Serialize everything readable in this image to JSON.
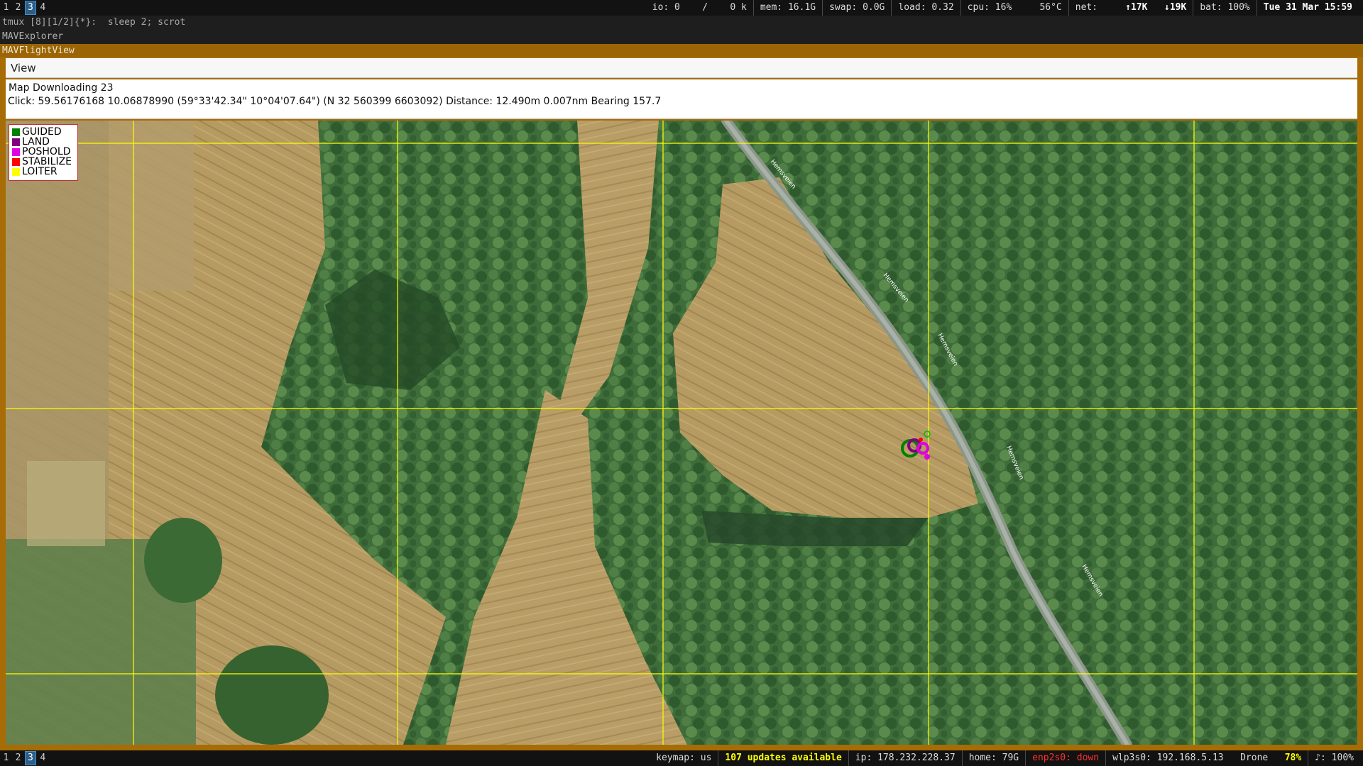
{
  "top_bar": {
    "workspaces": [
      "1",
      "2",
      "3",
      "4"
    ],
    "active_workspace": "3",
    "io": "io: 0",
    "io_sep": "/",
    "io_k": "0 k",
    "mem": "mem: 16.1G",
    "swap": "swap: 0.0G",
    "load": "load: 0.32",
    "cpu": "cpu:  16%",
    "temp": "56°C",
    "net_label": "net:",
    "net_up": "↑17K",
    "net_down": "↓19K",
    "bat": "bat: 100%",
    "datetime": "Tue 31 Mar 15:59"
  },
  "tmux_line": "tmux [8][1/2]{*}:  sleep 2; scrot",
  "explorer_title": "MAVExplorer",
  "window_title": "MAVFlightView",
  "menu": {
    "view_label": "View"
  },
  "info": {
    "line1": "Map Downloading 23",
    "line2": "Click: 59.56176168 10.06878990 (59°33'42.34\" 10°04'07.64\") (N 32 560399 6603092)  Distance: 12.490m 0.007nm Bearing 157.7"
  },
  "map": {
    "road_label": "Hemsveien",
    "grid_color": "#ffff00",
    "track_colors": [
      "#007f00",
      "#7f007f",
      "#e000e0",
      "#ff0000",
      "#ffff00"
    ]
  },
  "legend": {
    "items": [
      {
        "label": "GUIDED",
        "color": "#007f00"
      },
      {
        "label": "LAND",
        "color": "#7f007f"
      },
      {
        "label": "POSHOLD",
        "color": "#e000e0"
      },
      {
        "label": "STABILIZE",
        "color": "#ff0000"
      },
      {
        "label": "LOITER",
        "color": "#ffff00"
      }
    ]
  },
  "bottom_bar": {
    "workspaces": [
      "1",
      "2",
      "3",
      "4"
    ],
    "active_workspace": "3",
    "keymap": "keymap: us",
    "updates": "107 updates available",
    "ip": "ip: 178.232.228.37",
    "home": "home: 79G",
    "enp": "enp2s0: down",
    "wlp": "wlp3s0: 192.168.5.13",
    "wifi_name": "Drone",
    "wifi_pct": "78%",
    "volume": "♪: 100%"
  }
}
